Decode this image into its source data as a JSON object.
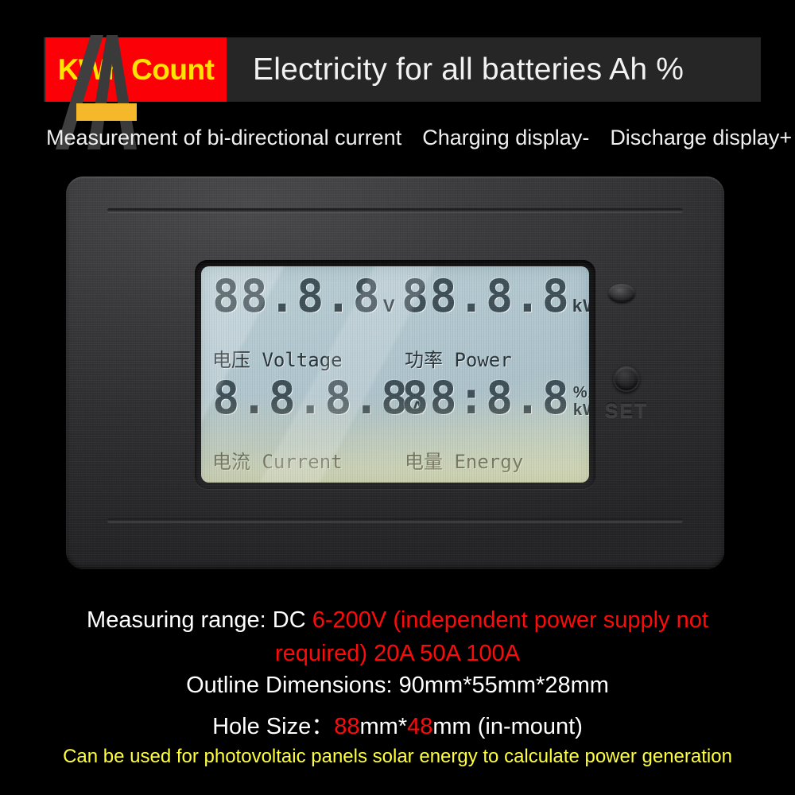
{
  "header": {
    "brand": "KWh Count",
    "title": "Electricity for all batteries Ah %",
    "brand_bg": "#fb0007",
    "brand_color": "#ffe400",
    "strip_bg": "#262626"
  },
  "subtitle": {
    "feature_1": "Measurement of bi-directional current",
    "feature_2": "Charging display-",
    "feature_3": "Discharge display+"
  },
  "device": {
    "set_button_label": "SET",
    "lcd": {
      "voltage": {
        "value": "88.8.8",
        "unit": "V",
        "label_cn": "电压",
        "label_en": "Voltage"
      },
      "power": {
        "value": "88.8.8",
        "unit": "kW",
        "label_cn": "功率",
        "label_en": "Power"
      },
      "current": {
        "value": "8.8.8.8",
        "unit": "A",
        "label_cn": "电流",
        "label_en": "Current"
      },
      "energy": {
        "value": "88:8.8",
        "unit_top": "%Ah",
        "unit_bottom": "kWh",
        "label_cn": "电量",
        "label_en": "Energy"
      },
      "panel_color": "#b3c8d0",
      "segment_color": "#3f5058"
    }
  },
  "specs": {
    "range_label": "Measuring range: ",
    "range_dc": "DC ",
    "range_value": "6-200V (independent power supply not",
    "range_value_2": "required) 20A 50A 100A",
    "outline": "Outline Dimensions: 90mm*55mm*28mm",
    "hole_label": "Hole Size：",
    "hole_w": "88",
    "hole_mid": "mm*",
    "hole_h": "48",
    "hole_tail": "mm (in-mount)",
    "footer_note": "Can be used for photovoltaic panels solar energy to calculate power generation",
    "accent_red": "#ff0a0a",
    "accent_yellow": "#ffff3a"
  }
}
